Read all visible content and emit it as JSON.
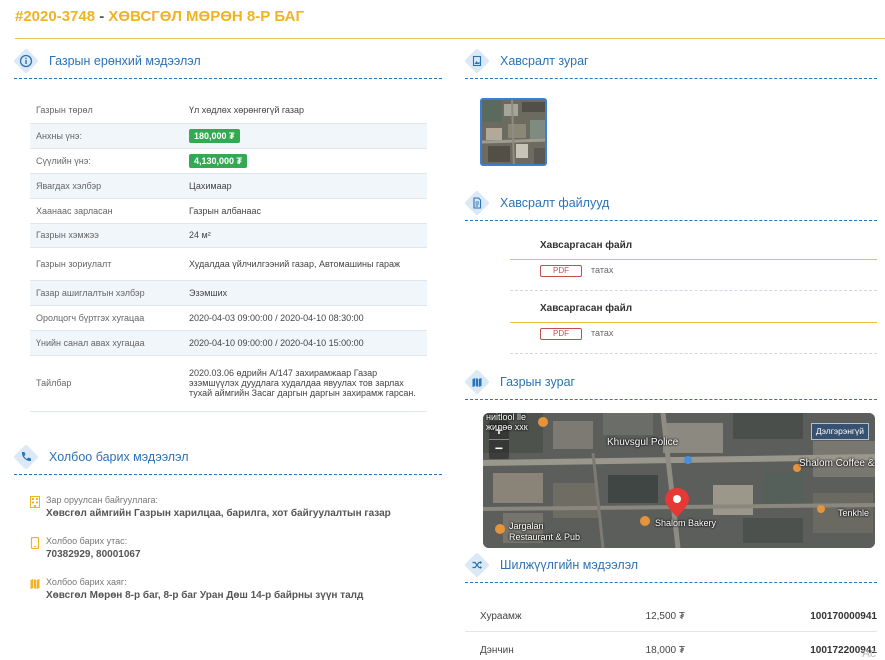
{
  "header": {
    "code": "#2020-3748",
    "separator": " - ",
    "title": "ХӨВСГӨЛ МӨРӨН 8-Р БАГ"
  },
  "general": {
    "title": "Газрын ерөнхий мэдээлэл",
    "icon": "info-icon",
    "rows": [
      {
        "label": "Газрын төрөл",
        "value": "Үл хөдлөх хөрөнгөгүй газар"
      },
      {
        "label": "Анхны үнэ:",
        "value": "180,000 ₮",
        "pill": true
      },
      {
        "label": "Сүүлийн үнэ:",
        "value": "4,130,000 ₮",
        "pill": true
      },
      {
        "label": "Явагдах хэлбэр",
        "value": "Цахимаар"
      },
      {
        "label": "Хаанаас зарласан",
        "value": "Газрын албанаас"
      },
      {
        "label": "Газрын хэмжээ",
        "value": "24 м²"
      },
      {
        "label": "Газрын зориулалт",
        "value": "Худалдаа үйлчилгээний газар, Автомашины гараж"
      },
      {
        "label": "Газар ашиглалтын хэлбэр",
        "value": "Эзэмших"
      },
      {
        "label": "Оролцогч бүртгэх хугацаа",
        "value": "2020-04-03 09:00:00 / 2020-04-10 08:30:00"
      },
      {
        "label": "Үнийн санал авах хугацаа",
        "value": "2020-04-10 09:00:00 / 2020-04-10 15:00:00"
      },
      {
        "label": "Тайлбар",
        "value": "2020.03.06 өдрийн А/147 захирамжаар Газар эзэмшүүлэх дуудлага худалдаа явуулах тов зарлах тухай аймгийн Засаг даргын даргын захирамж гарсан."
      }
    ]
  },
  "contact": {
    "title": "Холбоо барих мэдээлэл",
    "icon": "phone-icon",
    "items": [
      {
        "label": "Зар оруулсан байгууллага:",
        "value": "Хөвсгөл аймгийн Газрын харилцаа, барилга, хот байгуулалтын газар",
        "icon": "building-icon"
      },
      {
        "label": "Холбоо барих утас:",
        "value": "70382929, 80001067",
        "icon": "mobile-icon"
      },
      {
        "label": "Холбоо барих хаяг:",
        "value": "Хөвсгөл Мөрөн 8-р баг, 8-р баг Уран Дөш 14-р байрны зүүн талд",
        "icon": "map-icon"
      }
    ]
  },
  "attach_image": {
    "title": "Хавсралт зураг",
    "icon": "image-icon"
  },
  "attach_files": {
    "title": "Хавсралт файлууд",
    "icon": "file-icon",
    "files": [
      {
        "name": "Хавсаргасан файл",
        "type": "PDF",
        "download": "татах"
      },
      {
        "name": "Хавсаргасан файл",
        "type": "PDF",
        "download": "татах"
      }
    ]
  },
  "land_map": {
    "title": "Газрын зураг",
    "icon": "map-icon",
    "layer_button": "Дэлгэрэнгүй",
    "zoom_in": "+",
    "zoom_out": "−",
    "labels": {
      "top_left": "ниitlool lle",
      "top_left2": "жилөө ххк",
      "police": "Khuvsgul Police",
      "coffee": "Shalom Coffee &",
      "tenkhle": "Tenkhle",
      "jargalan": "Jargalan",
      "restaurant": "Restaurant & Pub",
      "bakery": "Shalom Bakery"
    }
  },
  "transfer": {
    "title": "Шилжүүлгийн мэдээлэл",
    "icon": "shuffle-icon",
    "rows": [
      {
        "name": "Хураамж",
        "amount": "12,500 ₮",
        "code": "100170000941"
      },
      {
        "name": "Дэнчин",
        "amount": "18,000 ₮",
        "code": "100172200941"
      }
    ]
  },
  "watermark": "Ac"
}
